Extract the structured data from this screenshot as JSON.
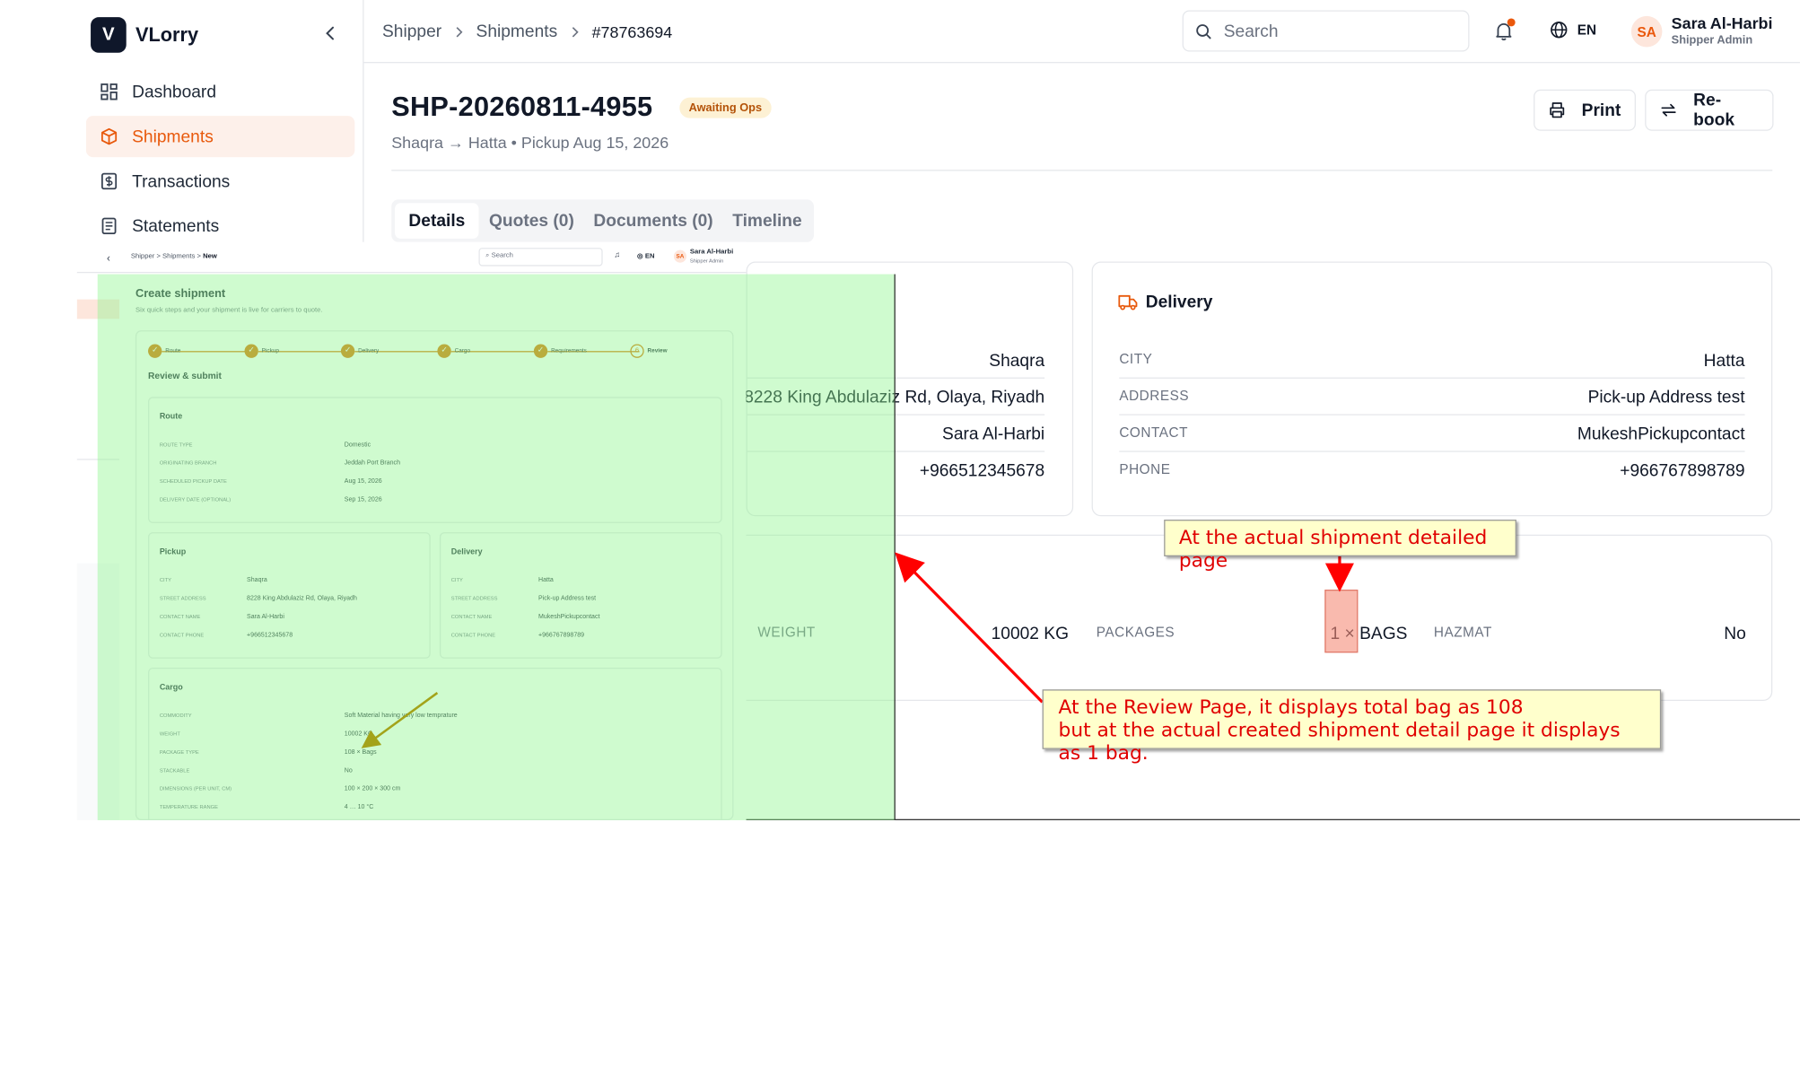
{
  "app": {
    "logo_letter": "V",
    "name": "VLorry"
  },
  "sidebar": {
    "items": [
      {
        "label": "Dashboard",
        "icon": "grid-icon"
      },
      {
        "label": "Shipments",
        "icon": "box-icon",
        "active": true
      },
      {
        "label": "Transactions",
        "icon": "dollar-doc-icon"
      },
      {
        "label": "Statements",
        "icon": "doc-lines-icon"
      }
    ]
  },
  "topbar": {
    "breadcrumb": [
      "Shipper",
      "Shipments",
      "#78763694"
    ],
    "search_placeholder": "Search",
    "language": "EN",
    "user": {
      "initials": "SA",
      "name": "Sara Al-Harbi",
      "role": "Shipper Admin"
    }
  },
  "shipment": {
    "id": "SHP-20260811-4955",
    "status": "Awaiting Ops",
    "route_line": "Shaqra → Hatta • Pickup Aug 15, 2026",
    "actions": {
      "print": "Print",
      "rebook": "Re-book"
    },
    "tabs": [
      "Details",
      "Quotes (0)",
      "Documents (0)",
      "Timeline"
    ],
    "pickup_values": [
      "Shaqra",
      "8228 King Abdulaziz Rd, Olaya, Riyadh",
      "Sara Al-Harbi",
      "+966512345678"
    ],
    "delivery": {
      "title": "Delivery",
      "rows": [
        {
          "label": "CITY",
          "value": "Hatta"
        },
        {
          "label": "ADDRESS",
          "value": "Pick-up Address test"
        },
        {
          "label": "CONTACT",
          "value": "MukeshPickupcontact"
        },
        {
          "label": "PHONE",
          "value": "+966767898789"
        }
      ]
    },
    "cargo": {
      "weight_label": "WEIGHT",
      "weight": "10002 KG",
      "packages_label": "PACKAGES",
      "packages": "1 × BAGS",
      "hazmat_label": "HAZMAT",
      "hazmat": "No"
    }
  },
  "review_screenshot": {
    "breadcrumb": [
      "Shipper",
      "Shipments",
      "New"
    ],
    "search_placeholder": "Search",
    "language": "EN",
    "user": {
      "initials": "SA",
      "name": "Sara Al-Harbi",
      "role": "Shipper Admin"
    },
    "title": "Create shipment",
    "subtitle": "Six quick steps and your shipment is live for carriers to quote.",
    "steps": [
      "Route",
      "Pickup",
      "Delivery",
      "Cargo",
      "Requirements",
      "Review"
    ],
    "review_step_number": "6",
    "section_title": "Review & submit",
    "route": {
      "title": "Route",
      "rows": [
        {
          "label": "ROUTE TYPE",
          "value": "Domestic"
        },
        {
          "label": "ORIGINATING BRANCH",
          "value": "Jeddah Port Branch"
        },
        {
          "label": "SCHEDULED PICKUP DATE",
          "value": "Aug 15, 2026"
        },
        {
          "label": "DELIVERY DATE (OPTIONAL)",
          "value": "Sep 15, 2026"
        }
      ]
    },
    "pickup": {
      "title": "Pickup",
      "rows": [
        {
          "label": "CITY",
          "value": "Shaqra"
        },
        {
          "label": "STREET ADDRESS",
          "value": "8228 King Abdulaziz Rd, Olaya, Riyadh"
        },
        {
          "label": "CONTACT NAME",
          "value": "Sara Al-Harbi"
        },
        {
          "label": "CONTACT PHONE",
          "value": "+966512345678"
        }
      ]
    },
    "delivery": {
      "title": "Delivery",
      "rows": [
        {
          "label": "CITY",
          "value": "Hatta"
        },
        {
          "label": "STREET ADDRESS",
          "value": "Pick-up Address test"
        },
        {
          "label": "CONTACT NAME",
          "value": "MukeshPickupcontact"
        },
        {
          "label": "CONTACT PHONE",
          "value": "+966767898789"
        }
      ]
    },
    "cargo": {
      "title": "Cargo",
      "rows": [
        {
          "label": "COMMODITY",
          "value": "Soft Material having very low temprature"
        },
        {
          "label": "WEIGHT",
          "value": "10002 KG"
        },
        {
          "label": "PACKAGE TYPE",
          "value": "108 × Bags"
        },
        {
          "label": "STACKABLE",
          "value": "No"
        },
        {
          "label": "DIMENSIONS (PER UNIT, CM)",
          "value": "100 × 200 × 300 cm"
        },
        {
          "label": "TEMPERATURE RANGE",
          "value": "4 … 10 °C"
        }
      ]
    }
  },
  "annotations": {
    "top_callout": "At the actual shipment detailed page",
    "bottom_callout_line1": "At the Review Page, it displays total bag as 108",
    "bottom_callout_line2": "but at the actual created shipment detail page it displays as 1 bag."
  },
  "colors": {
    "accent": "#e8590c",
    "highlight_green": "#8cf58c",
    "callout_bg": "#ffffcc",
    "callout_text": "#e00000",
    "arrow": "#ff0000"
  }
}
